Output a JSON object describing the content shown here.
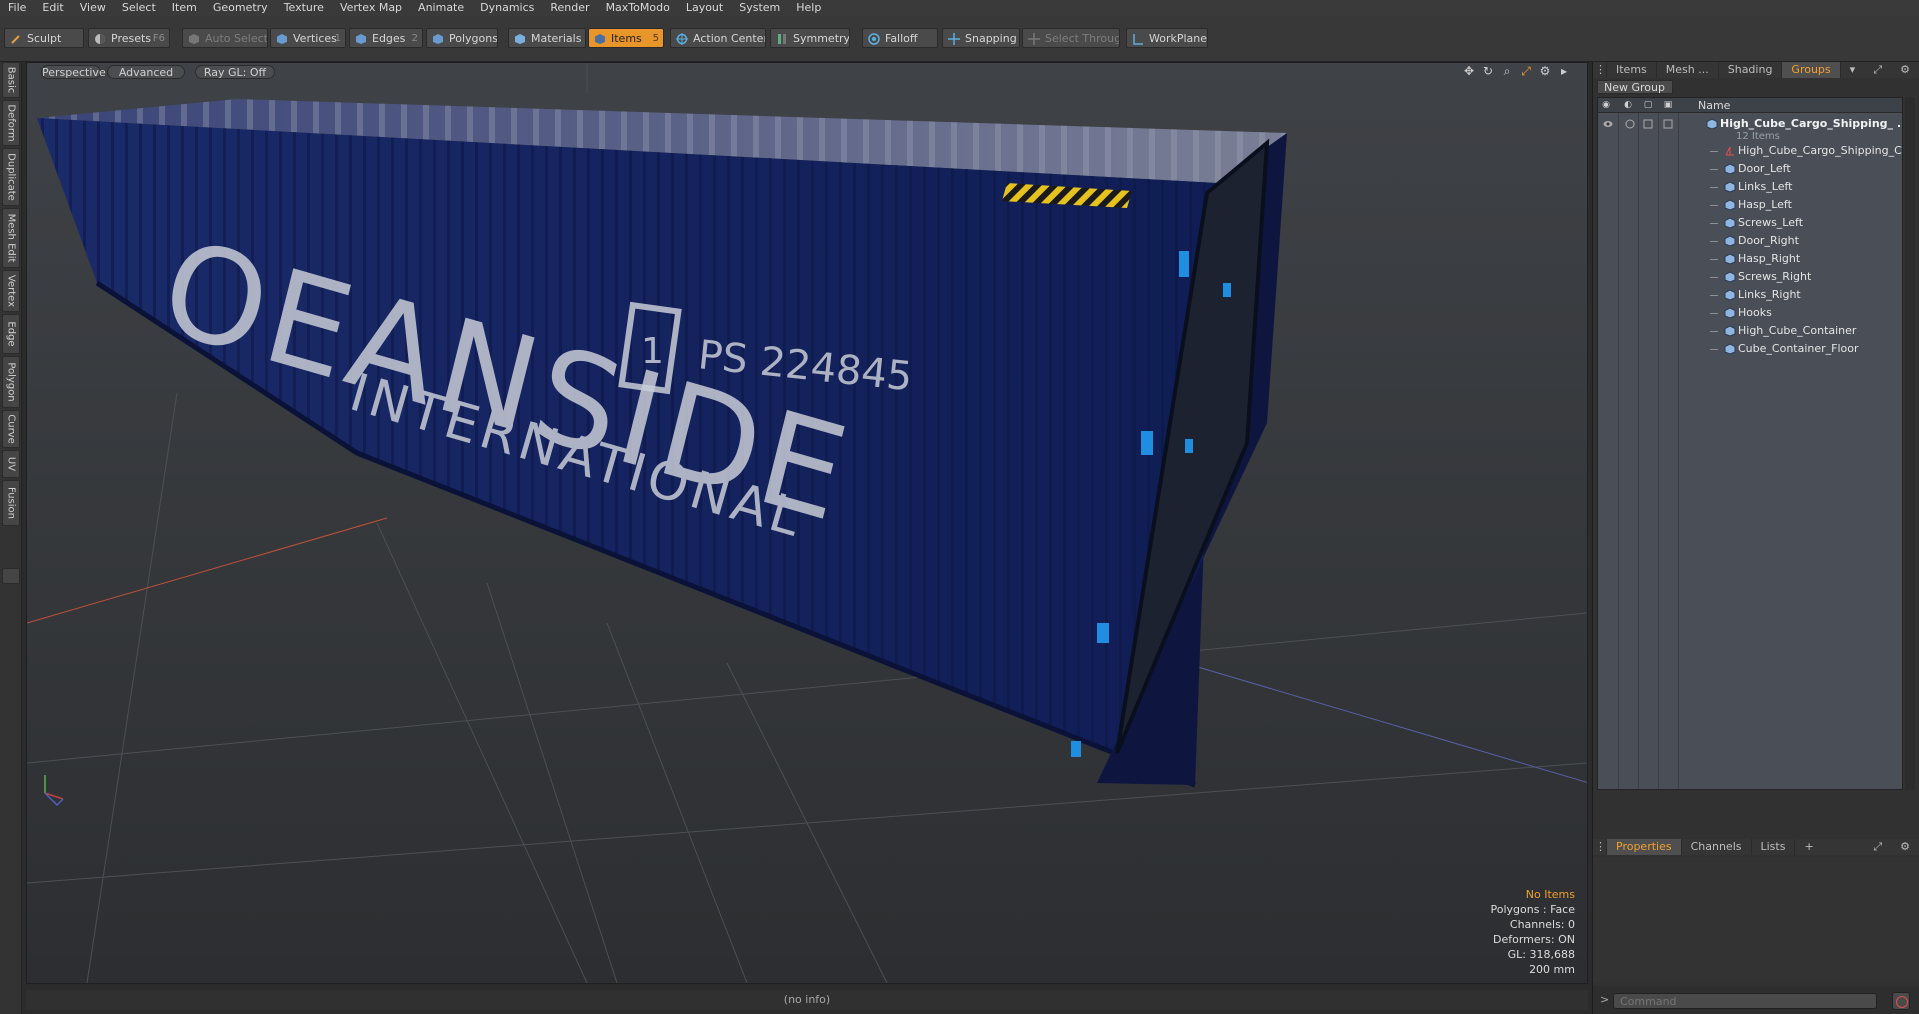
{
  "menu": [
    "File",
    "Edit",
    "View",
    "Select",
    "Item",
    "Geometry",
    "Texture",
    "Vertex Map",
    "Animate",
    "Dynamics",
    "Render",
    "MaxToModo",
    "Layout",
    "System",
    "Help"
  ],
  "toolbar": {
    "sculpt": "Sculpt",
    "presets": "Presets",
    "presets_key": "F6",
    "auto_select": "Auto Select",
    "vertices": "Vertices",
    "vertices_key": "1",
    "edges": "Edges",
    "edges_key": "2",
    "polygons": "Polygons",
    "materials": "Materials",
    "items": "Items",
    "items_key": "5",
    "action_center": "Action Center",
    "symmetry": "Symmetry",
    "falloff": "Falloff",
    "snapping": "Snapping",
    "select_through": "Select Through",
    "workplane": "WorkPlane"
  },
  "left_tabs": [
    "Basic",
    "Deform",
    "Duplicate",
    "Mesh Edit",
    "Vertex",
    "Edge",
    "Polygon",
    "Curve",
    "UV",
    "Fusion"
  ],
  "viewport": {
    "view": "Perspective",
    "shading": "Advanced",
    "raygl": "Ray GL: Off",
    "info": {
      "selection": "No Items",
      "polygons": "Polygons : Face",
      "channels": "Channels: 0",
      "deformers": "Deformers: ON",
      "gl": "GL: 318,688",
      "size": "200 mm"
    }
  },
  "statusbar": "(no info)",
  "right_panel": {
    "tabs": [
      "Items",
      "Mesh ...",
      "Shading",
      "Groups"
    ],
    "active_tab": "Groups",
    "new_group": "New Group",
    "column_name": "Name",
    "group": {
      "name": "High_Cube_Cargo_Shipping_ ...",
      "count": "12 Items"
    },
    "items": [
      "High_Cube_Cargo_Shipping_Co ...",
      "Door_Left",
      "Links_Left",
      "Hasp_Left",
      "Screws_Left",
      "Door_Right",
      "Hasp_Right",
      "Screws_Right",
      "Links_Right",
      "Hooks",
      "High_Cube_Container",
      "Cube_Container_Floor"
    ],
    "bottom_tabs": [
      "Properties",
      "Channels",
      "Lists"
    ],
    "bottom_add": "+",
    "command_placeholder": "Command",
    "command_arrow": ">"
  },
  "colors": {
    "accent": "#f0a030",
    "container": "#14205a",
    "panel": "#313131",
    "tree_bg": "#4a4f57"
  },
  "container_text": {
    "brand": "OEANSIDE",
    "sub": "INTERNATIONAL",
    "code": "PS 224845",
    "box": "1"
  }
}
